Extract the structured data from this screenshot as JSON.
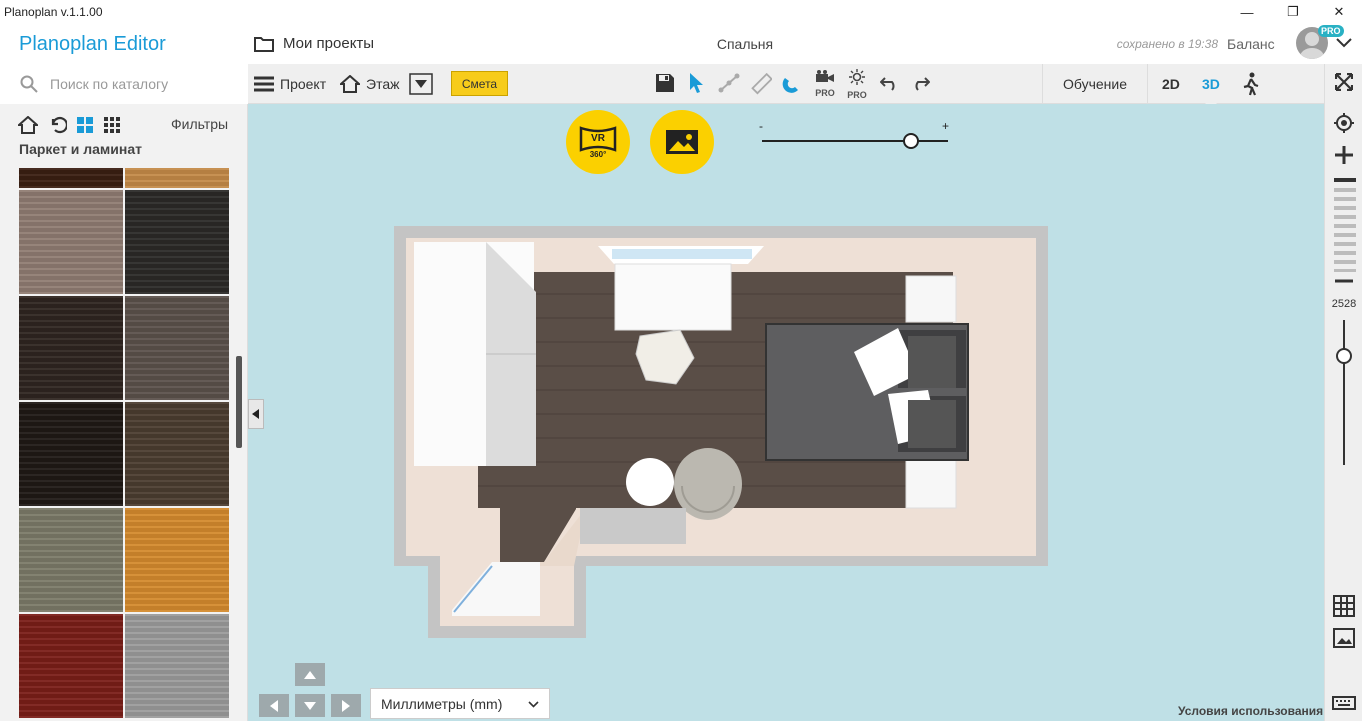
{
  "window": {
    "title": "Planoplan v.1.1.00",
    "controls": [
      "—",
      "❐",
      "✕"
    ]
  },
  "header": {
    "brand": "Planoplan Editor",
    "projects_label": "Мои проекты",
    "room_name": "Спальня",
    "saved_status": "сохранено в 19:38",
    "balance_label": "Баланс",
    "pro_badge": "PRO"
  },
  "search": {
    "placeholder": "Поиск по каталогу"
  },
  "catalog": {
    "filters_label": "Фильтры",
    "category_title": "Паркет и ламинат",
    "tiles": [
      {
        "color": "#3a1f12"
      },
      {
        "color": "#c48a48"
      },
      {
        "color": "#8f7c72"
      },
      {
        "color": "#2b2927"
      },
      {
        "color": "#2f2520"
      },
      {
        "color": "#5b514b"
      },
      {
        "color": "#1f1915"
      },
      {
        "color": "#4b3d30"
      },
      {
        "color": "#7b7a68"
      },
      {
        "color": "#d48a2d"
      },
      {
        "color": "#7a1e18"
      },
      {
        "color": "#9b9b9b"
      }
    ]
  },
  "toolbar": {
    "project_label": "Проект",
    "floor_label": "Этаж",
    "estimate_label": "Смета",
    "pro_label": "PRO",
    "learning_label": "Обучение",
    "mode_2d": "2D",
    "mode_3d": "3D",
    "active_mode": "3D"
  },
  "canvas": {
    "vr_label": "VR",
    "vr_sub": "360°",
    "slider_minus": "-",
    "slider_plus": "+",
    "slider_value": 0.8,
    "units_value": "Миллиметры (mm)",
    "terms_label": "Условия использования"
  },
  "right_rail": {
    "zoom_value": "2528",
    "zoom_level": 0.25
  },
  "colors": {
    "accent": "#1a9bd7",
    "yellow": "#fbd000",
    "canvas_bg": "#bfe0e6",
    "floor": "#5a4e47"
  }
}
